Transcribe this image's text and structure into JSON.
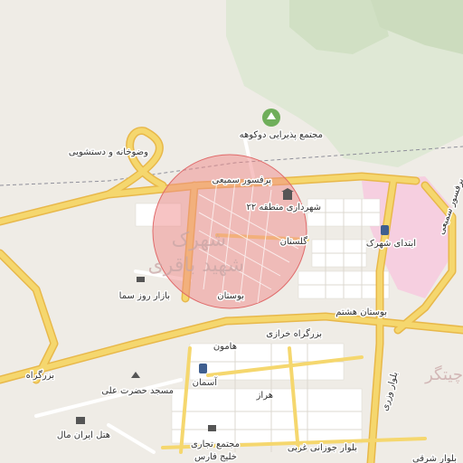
{
  "map": {
    "labels": {
      "dokuheh_complex": "مجتمع پذیرایی دوکوهه",
      "wc": "وضوخانه و دستشویی",
      "persasor_samiei": "پرفسور سمیعی",
      "persasor_samiei2": "پرفسور سمیعی",
      "municipality": "شهرداری منطقه ۲۲",
      "big_shahrak": "شهرک",
      "big_shahid": "شهید باقری",
      "golestan": "گلستان",
      "ebtedaye_shahrak": "ابتدای شهرک",
      "bazar_rooz": "بازار روز سما",
      "boostan": "بوستان",
      "boostan_hashtom": "بوستان هشتم",
      "khorazi": "بزرگراه خرازی",
      "hamoon": "هامون",
      "aseman": "آسمان",
      "bozorgrah": "بزرگراه",
      "masjed": "مسجد حضرت علی",
      "hotel": "هتل ایران مال",
      "heraz": "هراز",
      "tejari": "مجتمع تجاری",
      "khalij": "خلیج فارس",
      "javazani": "بلوار جوزانی غربی",
      "varzi": "بلوار وزری",
      "sharghi": "بلوار شرقی",
      "chitgar": "چیتگر"
    },
    "icons": [
      "tree-icon",
      "museum-icon",
      "bus-icon",
      "shopping-cart-icon",
      "mosque-icon",
      "hotel-icon"
    ],
    "colors": {
      "background": "#efece6",
      "green": "#d9e5cf",
      "highway": "#f5d76e",
      "highway_casing": "#e8b84a",
      "circle_fill": "#f08a8a",
      "circle_stroke": "#e06a6a",
      "pink_zone": "#f6cfe0"
    }
  }
}
